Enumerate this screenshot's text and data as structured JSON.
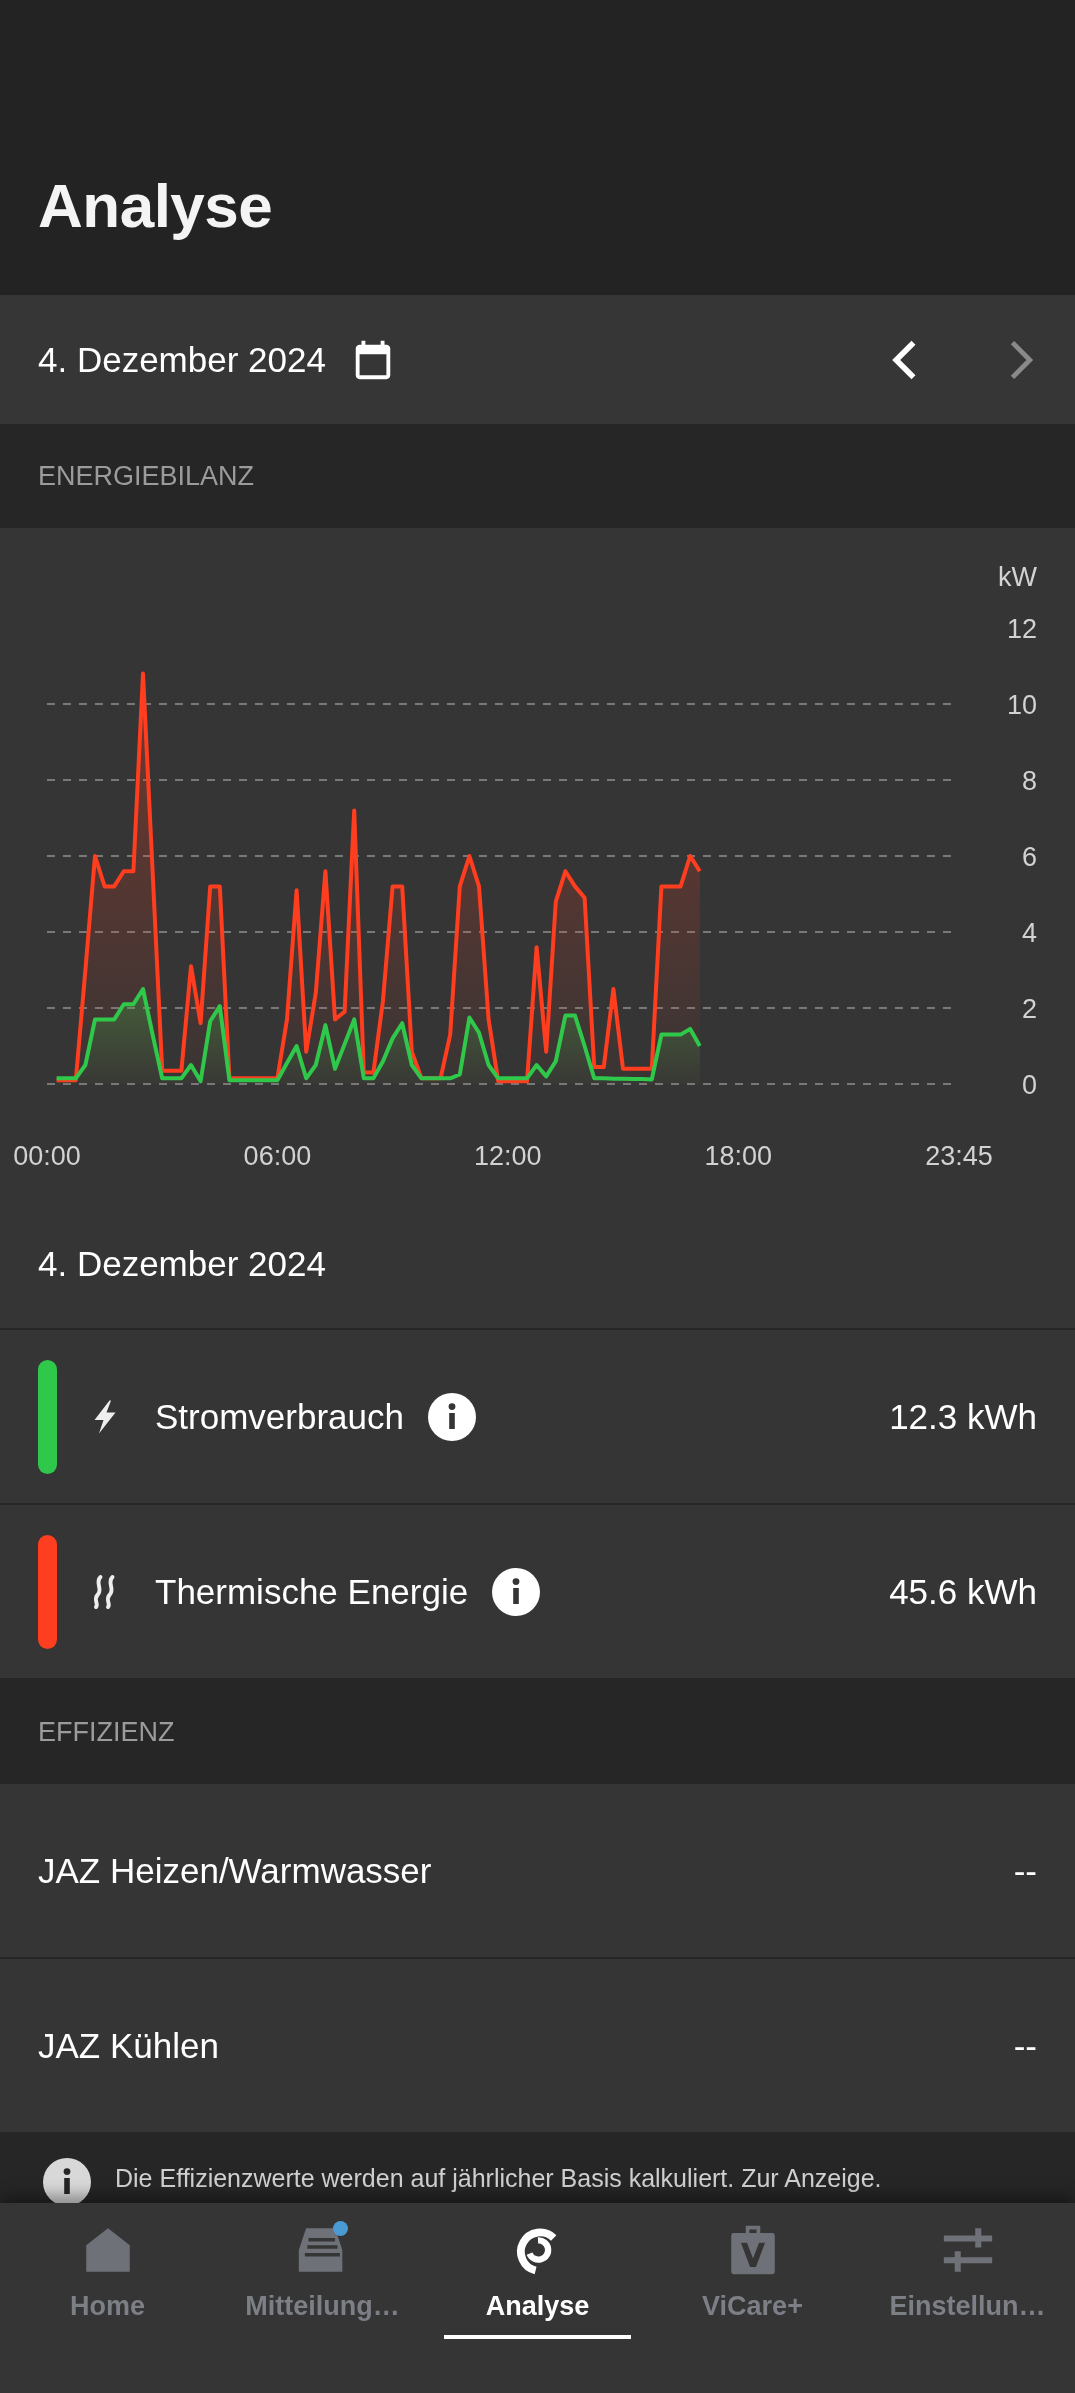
{
  "header": {
    "title": "Analyse"
  },
  "date_bar": {
    "date": "4. Dezember 2024",
    "nav_buttons": [
      {
        "disabled": false
      },
      {
        "disabled": true
      }
    ]
  },
  "energy_section": {
    "heading": "ENERGIEBILANZ",
    "chart_data": {
      "type": "area",
      "ylabel": "kW",
      "grid": true,
      "xlim": [
        0,
        23.75
      ],
      "ylim": [
        0,
        12
      ],
      "xticks": [
        {
          "value": 0,
          "label": "00:00"
        },
        {
          "value": 6,
          "label": "06:00"
        },
        {
          "value": 12,
          "label": "12:00"
        },
        {
          "value": 18,
          "label": "18:00"
        },
        {
          "value": 23.75,
          "label": "23:45"
        }
      ],
      "yticks": [
        0,
        2,
        4,
        6,
        8,
        10,
        12
      ],
      "x": [
        0.25,
        0.5,
        0.75,
        1,
        1.25,
        1.5,
        1.75,
        2,
        2.25,
        2.5,
        2.75,
        3,
        3.25,
        3.5,
        3.75,
        4,
        4.25,
        4.5,
        4.75,
        5,
        5.25,
        5.5,
        5.75,
        6,
        6.25,
        6.5,
        6.75,
        7,
        7.25,
        7.5,
        7.75,
        8,
        8.25,
        8.5,
        8.75,
        9,
        9.25,
        9.5,
        9.75,
        10,
        10.25,
        10.5,
        10.75,
        11,
        11.25,
        11.5,
        11.75,
        12,
        12.25,
        12.5,
        12.75,
        13,
        13.25,
        13.5,
        13.75,
        14,
        14.25,
        14.5,
        14.75,
        15,
        15.25,
        15.5,
        15.75,
        16,
        16.25,
        16.5,
        16.75,
        17
      ],
      "series": [
        {
          "name": "Stromverbrauch",
          "color": "#30c84a",
          "values": [
            0.15,
            0.15,
            0.15,
            0.5,
            1.7,
            1.7,
            1.7,
            2.1,
            2.1,
            2.5,
            1.3,
            0.15,
            0.15,
            0.15,
            0.5,
            0.07,
            1.65,
            2.05,
            0.1,
            0.1,
            0.1,
            0.1,
            0.1,
            0.1,
            0.55,
            1.0,
            0.15,
            0.5,
            1.55,
            0.4,
            1.05,
            1.7,
            0.15,
            0.15,
            0.6,
            1.2,
            1.6,
            0.5,
            0.15,
            0.15,
            0.15,
            0.15,
            0.25,
            1.75,
            1.35,
            0.5,
            0.15,
            0.15,
            0.15,
            0.15,
            0.5,
            0.2,
            0.6,
            1.8,
            1.8,
            1.0,
            0.15,
            0.15,
            0.14,
            0.14,
            0.13,
            0.13,
            0.12,
            1.3,
            1.3,
            1.3,
            1.45,
            1.0
          ]
        },
        {
          "name": "Thermische Energie",
          "color": "#ff3d1f",
          "values": [
            0.1,
            0.1,
            0.1,
            3.0,
            6.0,
            5.2,
            5.2,
            5.6,
            5.6,
            10.8,
            5.6,
            0.35,
            0.35,
            0.35,
            3.1,
            1.6,
            5.2,
            5.2,
            0.15,
            0.15,
            0.15,
            0.15,
            0.15,
            0.15,
            1.7,
            5.1,
            0.85,
            2.4,
            5.6,
            1.7,
            1.9,
            7.2,
            0.3,
            0.3,
            2.2,
            5.2,
            5.2,
            0.85,
            0.15,
            0.15,
            0.15,
            1.3,
            5.2,
            6.0,
            5.2,
            1.7,
            0.07,
            0.07,
            0.07,
            0.07,
            3.6,
            0.85,
            4.8,
            5.6,
            5.2,
            4.9,
            0.45,
            0.45,
            2.5,
            0.4,
            0.4,
            0.4,
            0.4,
            5.2,
            5.2,
            5.2,
            6.0,
            5.6
          ]
        }
      ]
    },
    "date": "4. Dezember 2024",
    "legend": [
      {
        "value": "12.3 kWh"
      },
      {
        "value": "45.6 kWh"
      }
    ]
  },
  "efficiency_section": {
    "heading": "EFFIZIENZ",
    "rows": [
      {
        "label": "JAZ Heizen/Warmwasser",
        "value": "--"
      },
      {
        "label": "JAZ Kühlen",
        "value": "--"
      }
    ],
    "note": "Die Effizienzwerte werden auf jährlicher Basis kalkuliert. Zur Anzeige."
  },
  "bottom_nav": [
    {
      "label": "Home",
      "selected": false,
      "badge": false
    },
    {
      "label": "Mitteilung…",
      "selected": false,
      "badge": true
    },
    {
      "label": "Analyse",
      "selected": true,
      "badge": false
    },
    {
      "label": "ViCare+",
      "selected": false,
      "badge": false
    },
    {
      "label": "Einstellun…",
      "selected": false,
      "badge": false
    }
  ]
}
